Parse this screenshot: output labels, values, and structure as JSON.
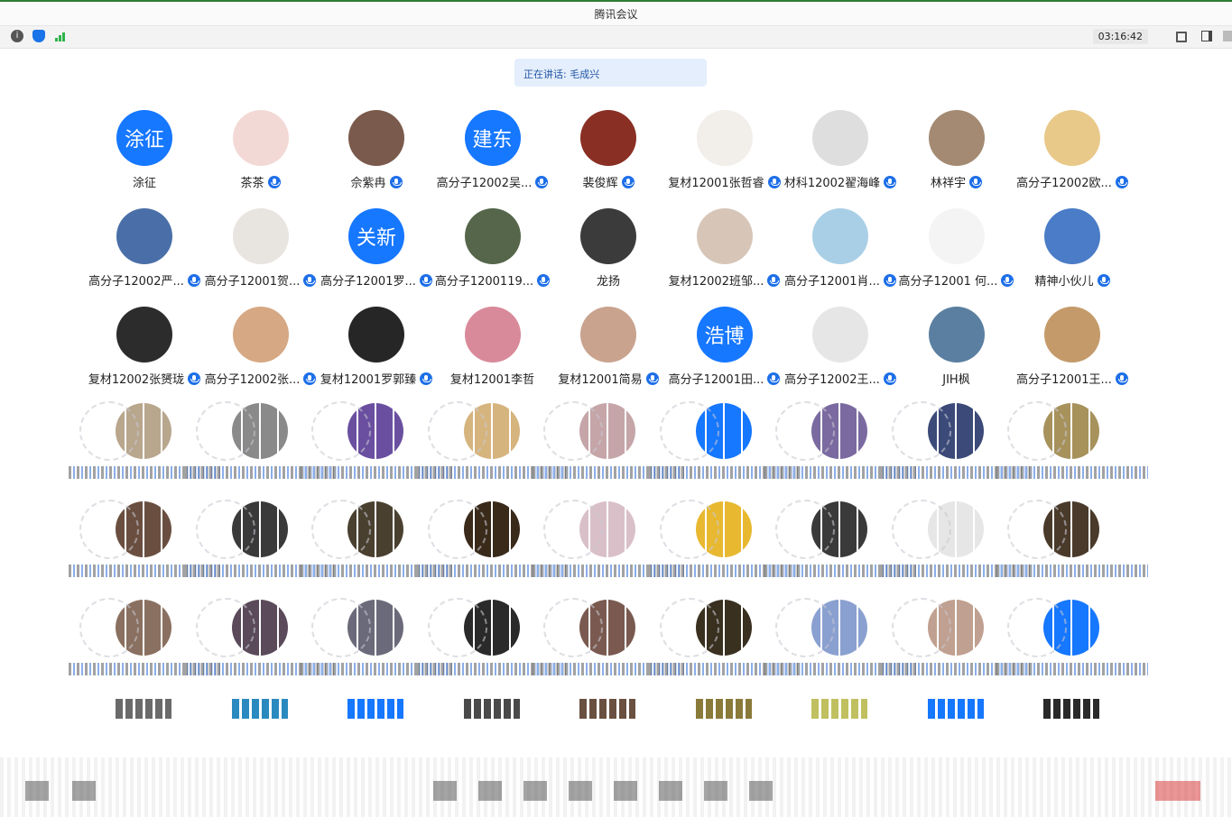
{
  "window": {
    "title": "腾讯会议"
  },
  "toolbar": {
    "icons": [
      "info-icon",
      "shield-icon",
      "signal-icon",
      "fullscreen-icon",
      "layout-icon"
    ],
    "timer": "03:16:42"
  },
  "speaking": {
    "text": "正在讲话: 毛成兴"
  },
  "participants": [
    {
      "name": "涂征",
      "avatar_text": "涂征",
      "mic": false,
      "color": "#1677ff"
    },
    {
      "name": "茶茶",
      "avatar_text": "",
      "mic": true,
      "color": "#f3d9d6"
    },
    {
      "name": "佘紫冉",
      "avatar_text": "",
      "mic": true,
      "color": "#7a5a4c"
    },
    {
      "name": "高分子12002吴...",
      "avatar_text": "建东",
      "mic": true,
      "color": "#1677ff"
    },
    {
      "name": "裴俊辉",
      "avatar_text": "",
      "mic": true,
      "color": "#8a2f24"
    },
    {
      "name": "复材12001张哲睿",
      "avatar_text": "",
      "mic": true,
      "color": "#f2eeea"
    },
    {
      "name": "材科12002翟海峰",
      "avatar_text": "",
      "mic": true,
      "color": "#dedede"
    },
    {
      "name": "林祥宇",
      "avatar_text": "",
      "mic": true,
      "color": "#a48a72"
    },
    {
      "name": "高分子12002欧...",
      "avatar_text": "",
      "mic": true,
      "color": "#e9c98a"
    },
    {
      "name": "高分子12002严...",
      "avatar_text": "",
      "mic": true,
      "color": "#4a6fa8"
    },
    {
      "name": "高分子12001贺...",
      "avatar_text": "",
      "mic": true,
      "color": "#e8e4e0"
    },
    {
      "name": "高分子12001罗...",
      "avatar_text": "关新",
      "mic": true,
      "color": "#1677ff"
    },
    {
      "name": "高分子1200119...",
      "avatar_text": "",
      "mic": true,
      "color": "#55664a"
    },
    {
      "name": "龙扬",
      "avatar_text": "",
      "mic": false,
      "color": "#3b3b3b"
    },
    {
      "name": "复材12002班邹...",
      "avatar_text": "",
      "mic": true,
      "color": "#d7c6b8"
    },
    {
      "name": "高分子12001肖...",
      "avatar_text": "",
      "mic": true,
      "color": "#a9cfe6"
    },
    {
      "name": "高分子12001 何...",
      "avatar_text": "",
      "mic": true,
      "color": "#f4f4f4"
    },
    {
      "name": "精神小伙儿",
      "avatar_text": "",
      "mic": true,
      "color": "#4a7cc7"
    },
    {
      "name": "复材12002张赟珑",
      "avatar_text": "",
      "mic": true,
      "color": "#2c2c2c"
    },
    {
      "name": "高分子12002张...",
      "avatar_text": "",
      "mic": true,
      "color": "#d6a883"
    },
    {
      "name": "复材12001罗郭臻",
      "avatar_text": "",
      "mic": true,
      "color": "#262626"
    },
    {
      "name": "复材12001李哲",
      "avatar_text": "",
      "mic": false,
      "color": "#d98a9a"
    },
    {
      "name": "复材12001简易",
      "avatar_text": "",
      "mic": true,
      "color": "#c9a38e"
    },
    {
      "name": "高分子12001田...",
      "avatar_text": "浩博",
      "mic": true,
      "color": "#1677ff"
    },
    {
      "name": "高分子12002王...",
      "avatar_text": "",
      "mic": true,
      "color": "#e6e6e6"
    },
    {
      "name": "JIH枫",
      "avatar_text": "",
      "mic": false,
      "color": "#5a7fa0"
    },
    {
      "name": "高分子12001王...",
      "avatar_text": "",
      "mic": true,
      "color": "#c49a6a"
    }
  ],
  "noisy_rows": [
    {
      "colors": [
        "#b8a68d",
        "#8a8a8a",
        "#6a4fa0",
        "#d6b47e",
        "#c5a5a8",
        "#1677ff",
        "#7a6aa0",
        "#3b4a78",
        "#a7925c"
      ]
    },
    {
      "colors": [
        "#6a4f40",
        "#3a3a3a",
        "#4a4030",
        "#3a2a1a",
        "#d9c0c8",
        "#e8b830",
        "#3a3a3a",
        "#e6e6e6",
        "#4a3a2a"
      ]
    },
    {
      "colors": [
        "#8a7060",
        "#5a4a5a",
        "#6a6a7a",
        "#2a2a2a",
        "#7a5a50",
        "#3a3020",
        "#8aa0d0",
        "#c0a090",
        "#1677ff"
      ]
    }
  ]
}
